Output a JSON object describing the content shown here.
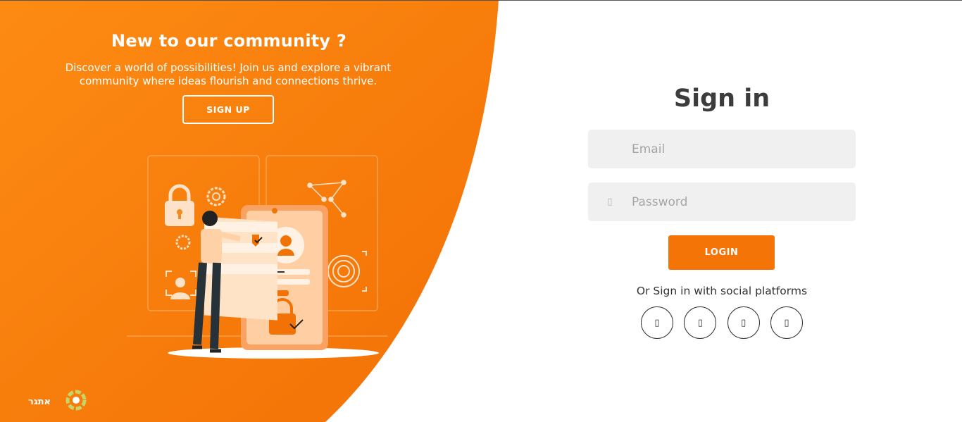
{
  "left": {
    "title": "New to our community ?",
    "description": "Discover a world of possibilities! Join us and explore a vibrant community where ideas flourish and connections thrive.",
    "signup_label": "SIGN UP",
    "logo_text": "אתגר"
  },
  "right": {
    "title": "Sign in",
    "email_placeholder": "Email",
    "password_placeholder": "Password",
    "login_label": "LOGIN",
    "social_text": "Or Sign in with social platforms",
    "email_icon": "",
    "password_icon": "▯",
    "social": [
      {
        "icon": "facebook-icon",
        "glyph": "▯"
      },
      {
        "icon": "twitter-icon",
        "glyph": "▯"
      },
      {
        "icon": "google-icon",
        "glyph": "▯"
      },
      {
        "icon": "linkedin-icon",
        "glyph": "▯"
      }
    ]
  },
  "colors": {
    "accent": "#f47407",
    "panel_gradient_start": "#fd8a12",
    "panel_gradient_end": "#f37206",
    "title_text": "#3c3c3c",
    "field_bg": "#f0f0f0"
  }
}
